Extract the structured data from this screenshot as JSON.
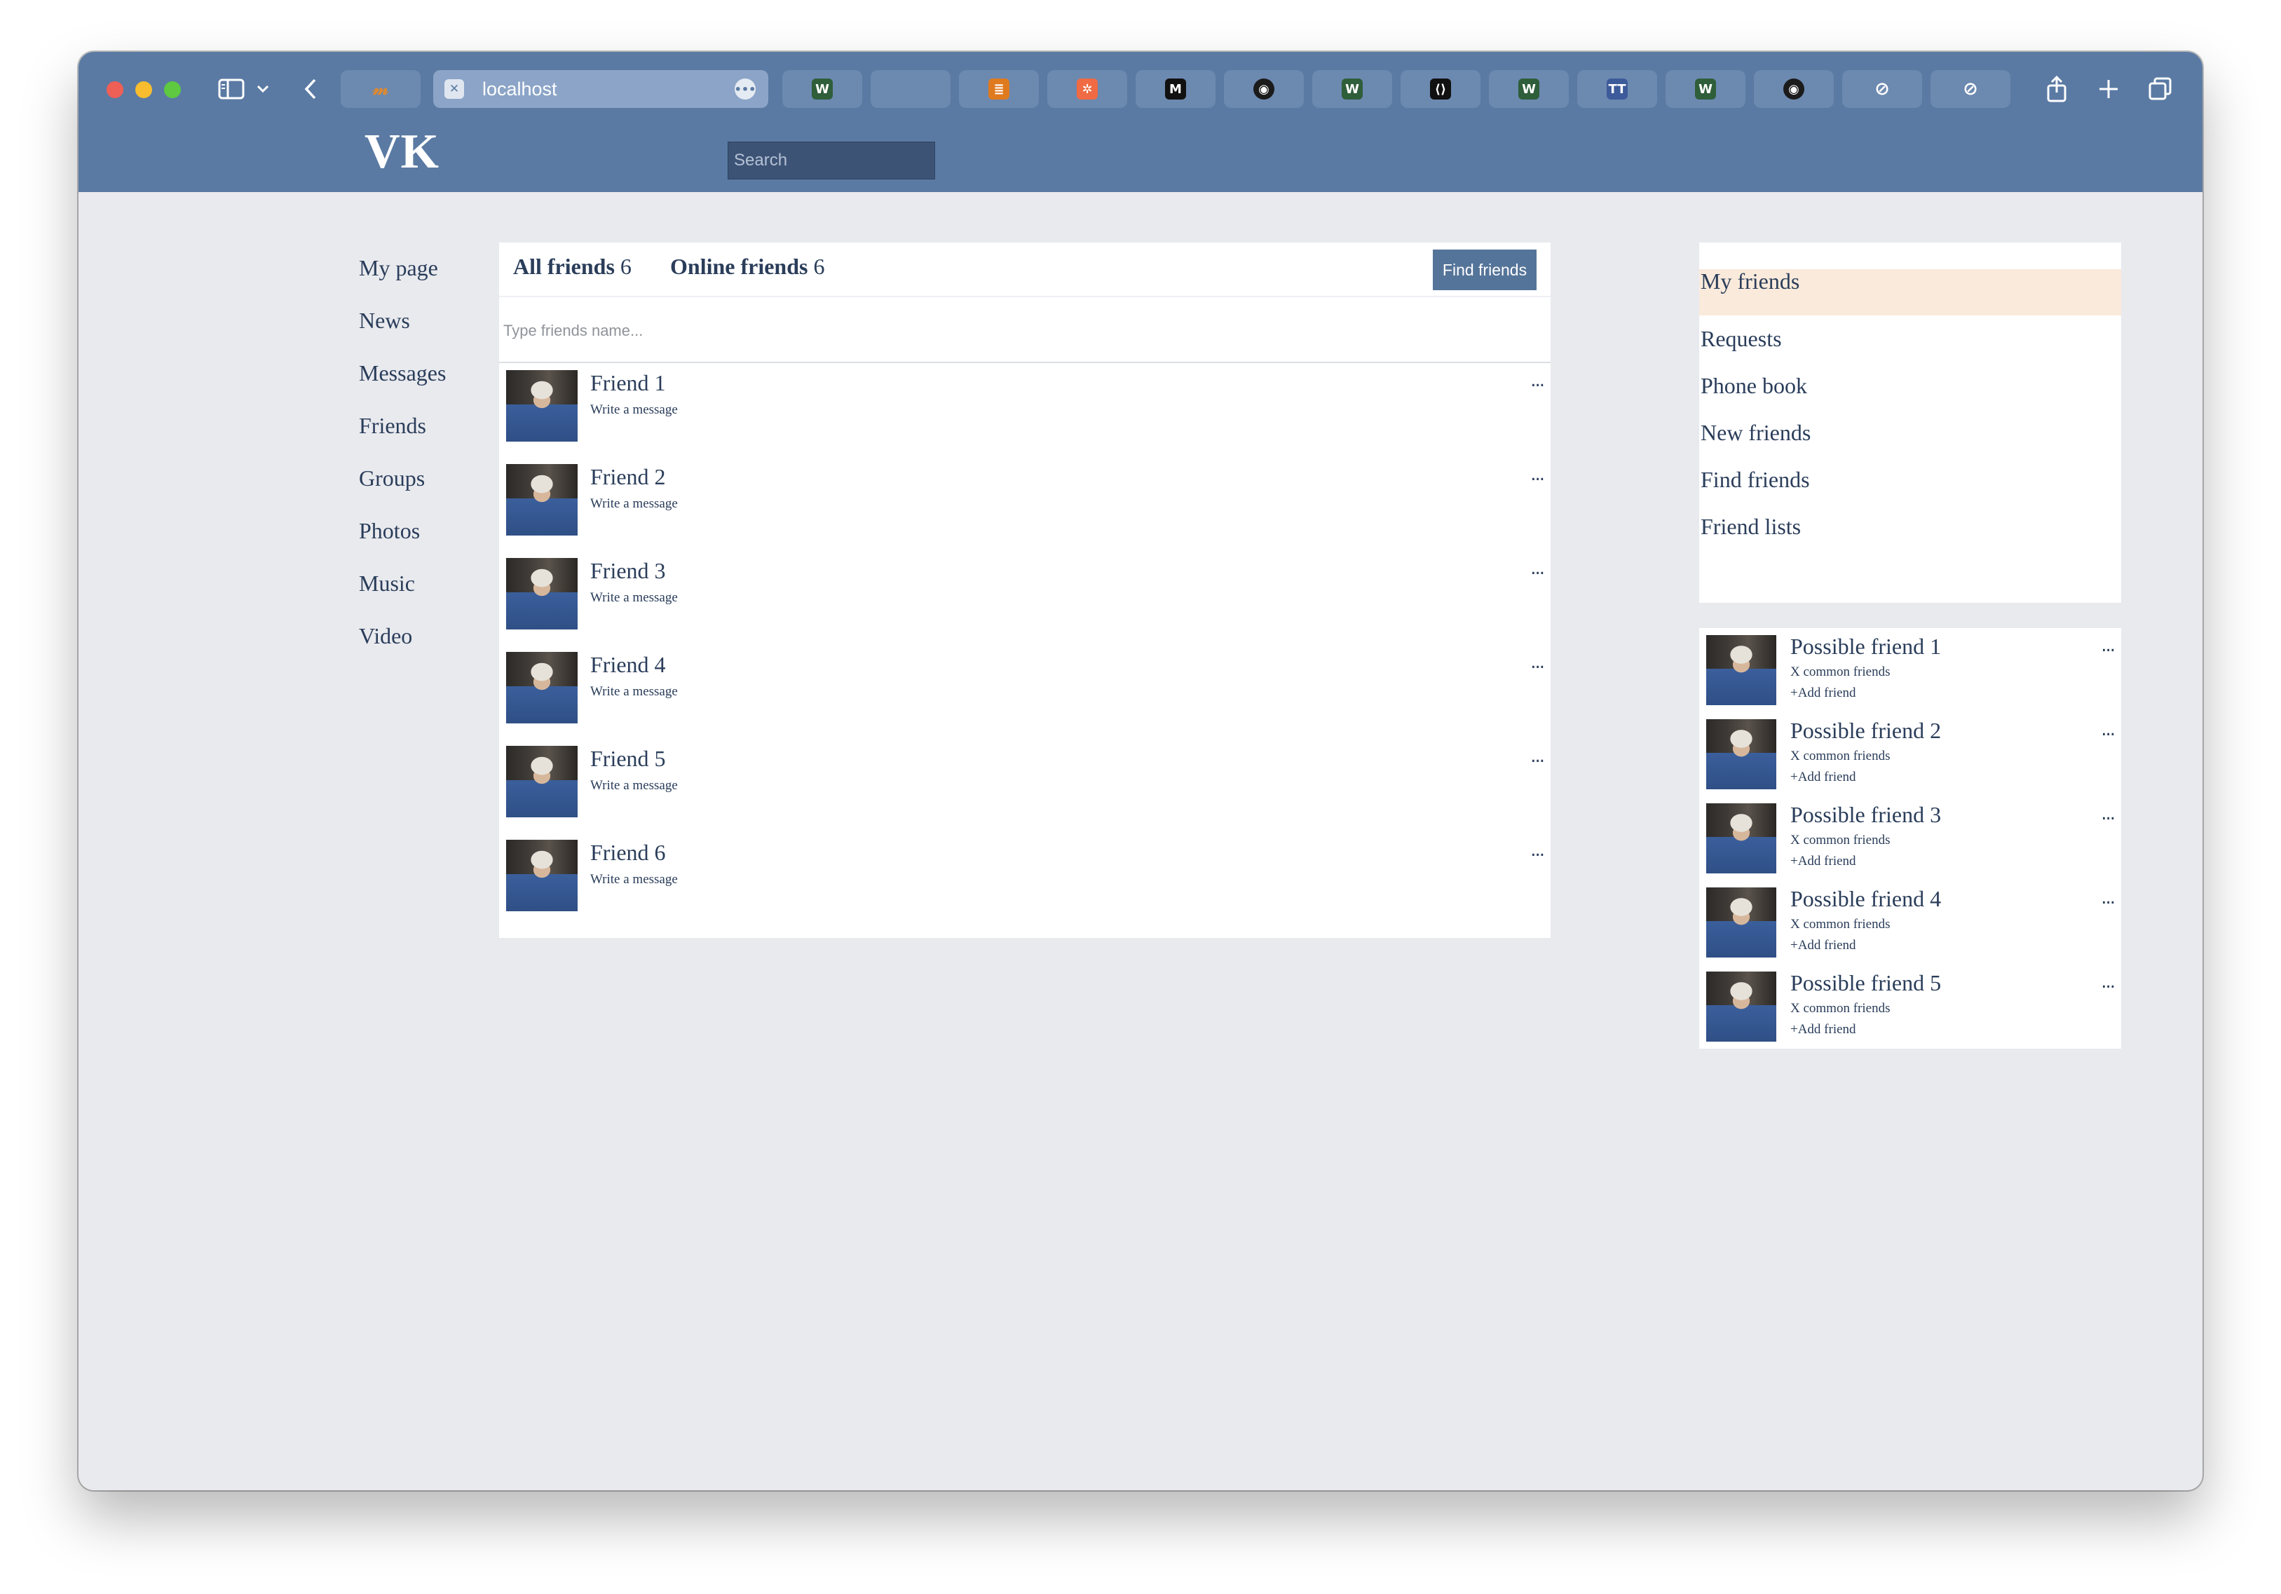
{
  "browser": {
    "url": "localhost",
    "active_tab_icon": "x-square-icon",
    "tabs_left": [
      {
        "icon": "mouse-favicon-icon",
        "glyph": "🐭"
      }
    ],
    "tabs_right": [
      {
        "icon": "w-green-favicon-icon",
        "glyph": "W",
        "color": "#2f5e3a"
      },
      {
        "icon": "blank-tab-icon",
        "glyph": "",
        "color": "#6c89b0"
      },
      {
        "icon": "stack-overflow-icon",
        "glyph": "≣",
        "color": "#e07a1f"
      },
      {
        "icon": "hubspot-icon",
        "glyph": "✲",
        "color": "#f06a43"
      },
      {
        "icon": "medium-icon",
        "glyph": "M",
        "color": "#111111"
      },
      {
        "icon": "github-icon",
        "glyph": "◉",
        "color": "#1b1b1b"
      },
      {
        "icon": "w-green-favicon-icon",
        "glyph": "W",
        "color": "#2f5e3a"
      },
      {
        "icon": "angle-brackets-icon",
        "glyph": "⟨⟩",
        "color": "#111111"
      },
      {
        "icon": "w-green-favicon-icon",
        "glyph": "W",
        "color": "#2f5e3a"
      },
      {
        "icon": "tt-favicon-icon",
        "glyph": "TT",
        "color": "#3d5b9a"
      },
      {
        "icon": "w-green-favicon-icon",
        "glyph": "W",
        "color": "#2f5e3a"
      },
      {
        "icon": "github-icon",
        "glyph": "◉",
        "color": "#1b1b1b"
      },
      {
        "icon": "compass-icon",
        "glyph": "⊘",
        "color": "#6c89b0"
      },
      {
        "icon": "compass-icon",
        "glyph": "⊘",
        "color": "#6c89b0"
      }
    ]
  },
  "header": {
    "logo": "VK",
    "search_placeholder": "Search"
  },
  "leftnav": {
    "items": [
      "My page",
      "News",
      "Messages",
      "Friends",
      "Groups",
      "Photos",
      "Music",
      "Video"
    ]
  },
  "friends_panel": {
    "tab_all_label": "All friends",
    "tab_all_count": "6",
    "tab_online_label": "Online friends",
    "tab_online_count": "6",
    "find_button": "Find friends",
    "filter_placeholder": "Type friends name...",
    "friends": [
      {
        "name": "Friend 1",
        "action": "Write a message",
        "more": "..."
      },
      {
        "name": "Friend 2",
        "action": "Write a message",
        "more": "..."
      },
      {
        "name": "Friend 3",
        "action": "Write a message",
        "more": "..."
      },
      {
        "name": "Friend 4",
        "action": "Write a message",
        "more": "..."
      },
      {
        "name": "Friend 5",
        "action": "Write a message",
        "more": "..."
      },
      {
        "name": "Friend 6",
        "action": "Write a message",
        "more": "..."
      }
    ]
  },
  "right_menu": {
    "items": [
      "My friends",
      "Requests",
      "Phone book",
      "New friends",
      "Find friends",
      "Friend lists"
    ],
    "active_index": 0,
    "active_color": "#faeadb"
  },
  "possible_friends": [
    {
      "name": "Possible friend 1",
      "common": "X common friends",
      "add": "+Add friend",
      "more": "..."
    },
    {
      "name": "Possible friend 2",
      "common": "X common friends",
      "add": "+Add friend",
      "more": "..."
    },
    {
      "name": "Possible friend 3",
      "common": "X common friends",
      "add": "+Add friend",
      "more": "..."
    },
    {
      "name": "Possible friend 4",
      "common": "X common friends",
      "add": "+Add friend",
      "more": "..."
    },
    {
      "name": "Possible friend 5",
      "common": "X common friends",
      "add": "+Add friend",
      "more": "..."
    }
  ],
  "colors": {
    "header_bg": "#5a7aa3",
    "page_bg": "#e9eaee",
    "link_text": "#2a3d5a",
    "button_bg": "#557499"
  }
}
